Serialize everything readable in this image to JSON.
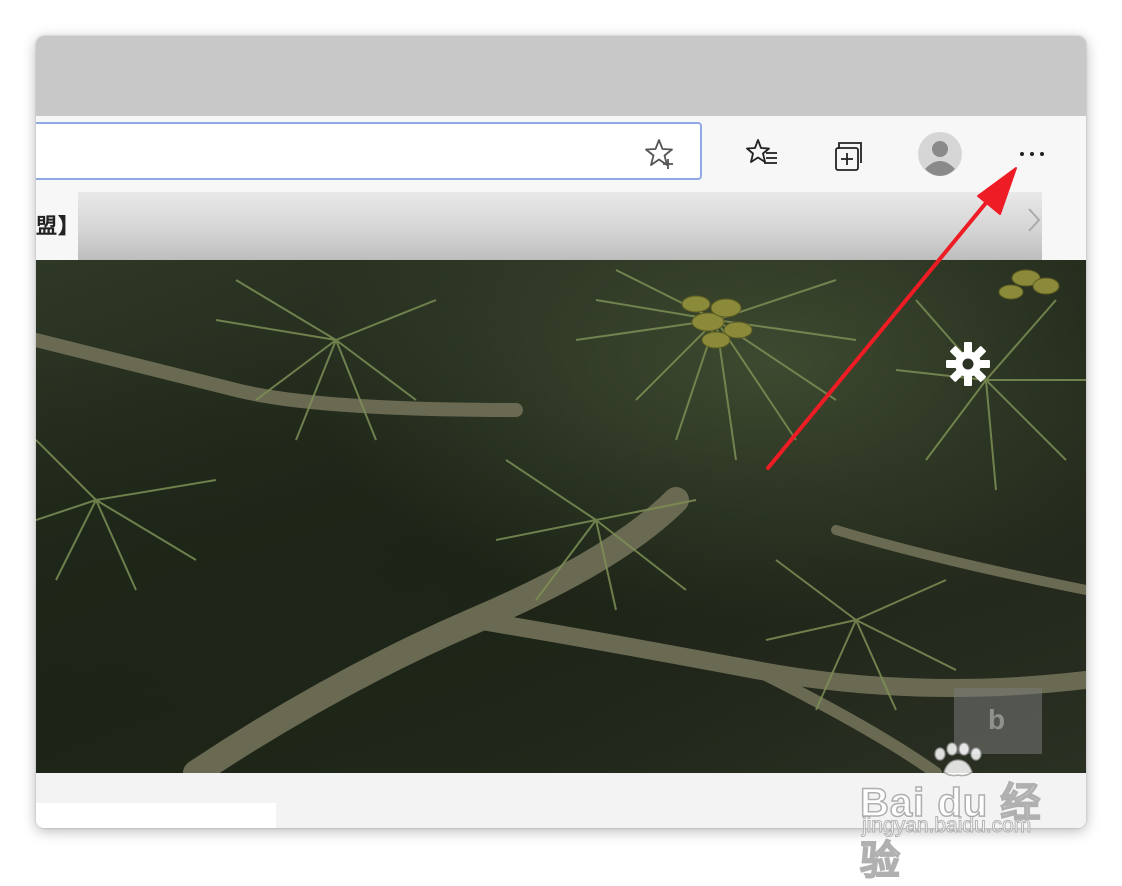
{
  "favorites_bar": {
    "visible_text": "盟】V"
  },
  "toolbar": {
    "add_favorite_icon": "star-plus-icon",
    "favorites_icon": "star-list-icon",
    "collections_icon": "collections-icon",
    "profile_icon": "avatar",
    "more_icon": "ellipsis-icon",
    "more_label": "···"
  },
  "background": {
    "settings_icon": "gear-icon",
    "bing_icon": "bing-logo"
  },
  "watermark": {
    "logo": "Bai du 经验",
    "url": "jingyan.baidu.com"
  },
  "annotation": {
    "arrow_color": "#ee1c24"
  }
}
